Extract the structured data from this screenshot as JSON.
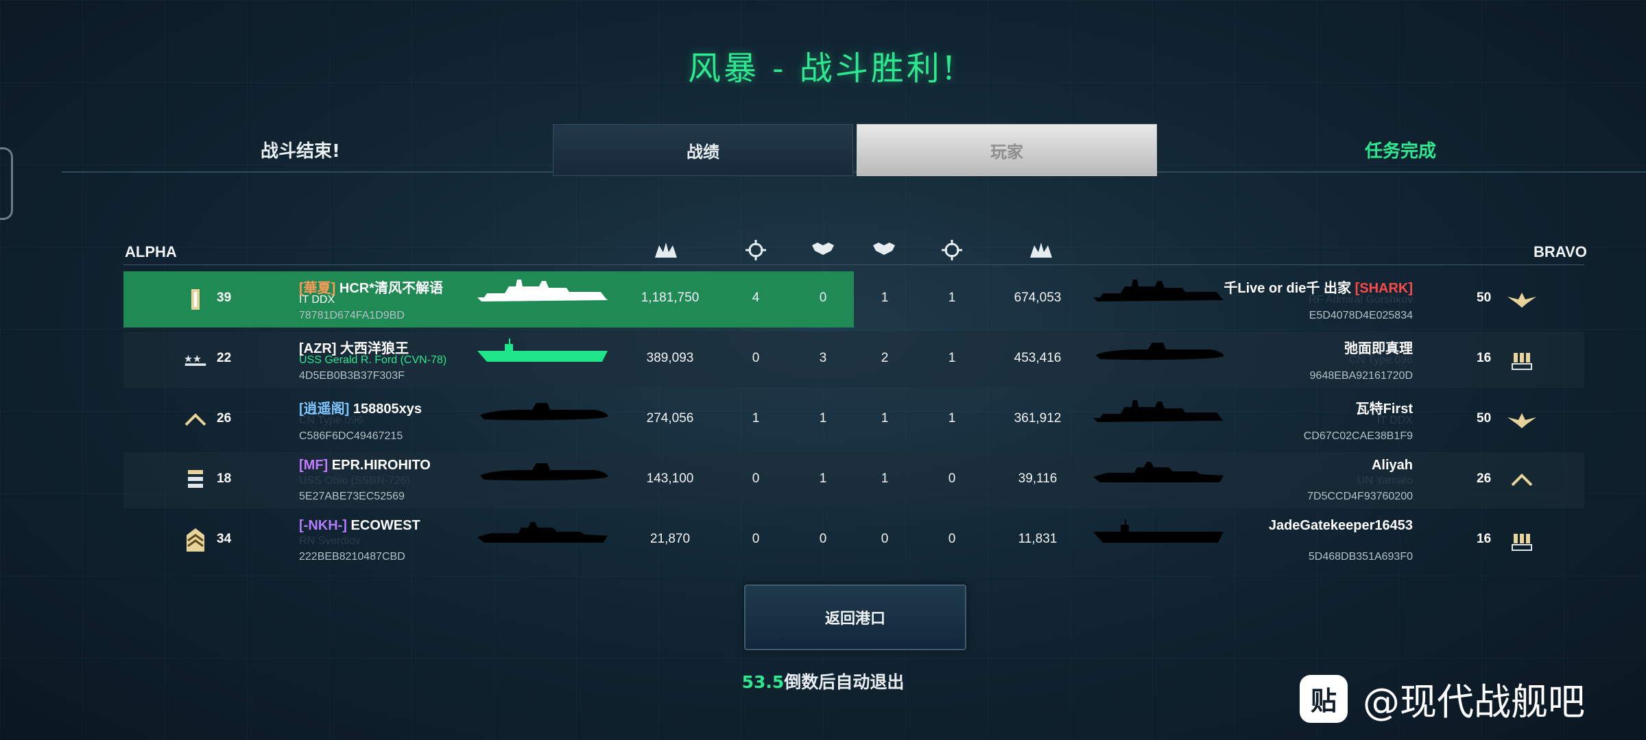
{
  "title": "风暴 - 战斗胜利!",
  "status_left": "战斗结束!",
  "status_right": "任务完成",
  "tabs": [
    {
      "label": "战绩",
      "active": true
    },
    {
      "label": "玩家",
      "active": false
    }
  ],
  "teams": {
    "alpha": "ALPHA",
    "bravo": "BRAVO"
  },
  "header_icons": [
    "damage-icon",
    "crosshair-icon",
    "handshake-icon",
    "handshake-icon",
    "crosshair-icon",
    "damage-icon"
  ],
  "alpha": [
    {
      "rank_icon": "lieutenant-icon",
      "level": "39",
      "clan": "[華夏]",
      "clan_color": "#ff9a5a",
      "name": "HCR*清风不解语",
      "ship": "IT DDX",
      "ship_color": "#ffffff",
      "id": "78781D674FA1D9BD",
      "damage": "1,181,750",
      "kills": "4",
      "assists": "0",
      "highlight": true,
      "ship_silhouette": "destroyer",
      "silhouette_color": "#ffffff"
    },
    {
      "rank_icon": "stars-icon",
      "level": "22",
      "clan": "[AZR]",
      "clan_color": "#ffffff",
      "name": "大西洋狼王",
      "ship": "USS Gerald R. Ford (CVN-78)",
      "ship_color": "#2ee88f",
      "id": "4D5EB0B3B37F303F",
      "damage": "389,093",
      "kills": "0",
      "assists": "3",
      "highlight": false,
      "ship_silhouette": "carrier",
      "silhouette_color": "#1fe58a"
    },
    {
      "rank_icon": "chevron-icon",
      "level": "26",
      "clan": "[逍遥阁]",
      "clan_color": "#7fc6ff",
      "name": "158805xys",
      "ship": "CN Type 096",
      "ship_color": "#2b3c4a",
      "id": "C586F6DC49467215",
      "damage": "274,056",
      "kills": "1",
      "assists": "1",
      "highlight": false,
      "ship_silhouette": "submarine",
      "silhouette_color": "#000000"
    },
    {
      "rank_icon": "bars-icon",
      "level": "18",
      "clan": "[MF]",
      "clan_color": "#c27bff",
      "name": "EPR.HIROHITO",
      "ship": "USS Ohio (SSBN-726)",
      "ship_color": "#2b3c4a",
      "id": "5E27ABE73EC52569",
      "damage": "143,100",
      "kills": "0",
      "assists": "1",
      "highlight": false,
      "ship_silhouette": "submarine",
      "silhouette_color": "#000000"
    },
    {
      "rank_icon": "sergeant-icon",
      "level": "34",
      "clan": "[-NKH-]",
      "clan_color": "#b57cff",
      "name": "ECOWEST",
      "ship": "RN Sverdlov",
      "ship_color": "#2b3c4a",
      "id": "222BEB8210487CBD",
      "damage": "21,870",
      "kills": "0",
      "assists": "0",
      "highlight": false,
      "ship_silhouette": "cruiser",
      "silhouette_color": "#000000"
    }
  ],
  "bravo": [
    {
      "rank_icon": "eagle-icon",
      "level": "50",
      "clan": "[SHARK]",
      "clan_color": "#ff4a4a",
      "name": "千Live or die千 出家",
      "ship": "RF Admiral Gorshkov",
      "ship_color": "#2b3c4a",
      "id": "E5D4078D4E025834",
      "damage": "674,053",
      "kills": "1",
      "assists": "1",
      "ship_silhouette": "destroyer",
      "silhouette_color": "#000000"
    },
    {
      "rank_icon": "shells-icon",
      "level": "16",
      "clan": "",
      "clan_color": "#ffffff",
      "name": "弛面即真理",
      "ship": "CN Type 096",
      "ship_color": "#2b3c4a",
      "id": "9648EBA92161720D",
      "damage": "453,416",
      "kills": "1",
      "assists": "2",
      "ship_silhouette": "submarine",
      "silhouette_color": "#000000"
    },
    {
      "rank_icon": "eagle-icon",
      "level": "50",
      "clan": "",
      "clan_color": "#ffffff",
      "name": "瓦特First",
      "ship": "IT DDX",
      "ship_color": "#2b3c4a",
      "id": "CD67C02CAE38B1F9",
      "damage": "361,912",
      "kills": "1",
      "assists": "1",
      "ship_silhouette": "destroyer",
      "silhouette_color": "#000000"
    },
    {
      "rank_icon": "chevron-icon",
      "level": "26",
      "clan": "",
      "clan_color": "#ffffff",
      "name": "Aliyah",
      "ship": "UN Yamato",
      "ship_color": "#2b3c4a",
      "id": "7D5CCD4F93760200",
      "damage": "39,116",
      "kills": "0",
      "assists": "1",
      "ship_silhouette": "cruiser",
      "silhouette_color": "#000000"
    },
    {
      "rank_icon": "shells-icon",
      "level": "16",
      "clan": "",
      "clan_color": "#ffffff",
      "name": "JadeGatekeeper16453",
      "ship": "",
      "ship_color": "#2b3c4a",
      "id": "5D468DB351A693F0",
      "damage": "11,831",
      "kills": "0",
      "assists": "0",
      "ship_silhouette": "carrier",
      "silhouette_color": "#000000"
    }
  ],
  "return_button": "返回港口",
  "countdown_seconds": "53.5",
  "countdown_text": "倒数后自动退出",
  "watermark": {
    "logo": "贴",
    "text": "@现代战舰吧"
  }
}
